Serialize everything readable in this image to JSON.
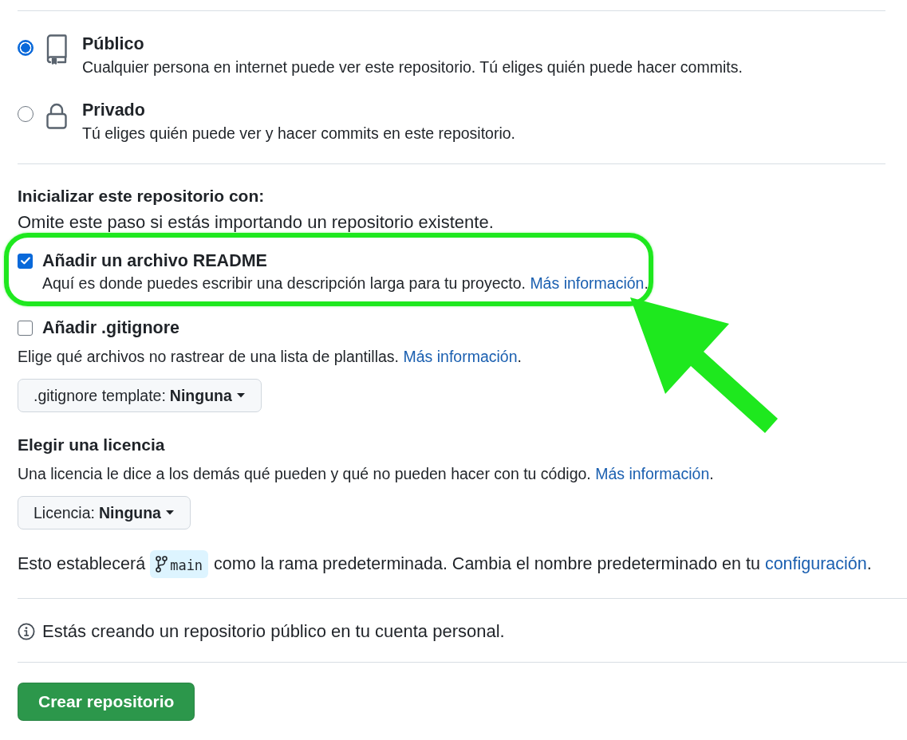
{
  "visibility_options": [
    {
      "kind": "public",
      "title": "Público",
      "description": "Cualquier persona en internet puede ver este repositorio. Tú eliges quién puede hacer commits.",
      "selected": true
    },
    {
      "kind": "private",
      "title": "Privado",
      "description": "Tú eliges quién puede ver y hacer commits en este repositorio.",
      "selected": false
    }
  ],
  "initialize": {
    "heading": "Inicializar este repositorio con:",
    "note": "Omite este paso si estás importando un repositorio existente.",
    "options": [
      {
        "label": "Añadir un archivo README",
        "checked": true,
        "highlighted": true,
        "description": "Aquí es donde puedes escribir una descripción larga para tu proyecto.",
        "link": "Más información",
        "after_link": "."
      },
      {
        "label": "Añadir .gitignore",
        "checked": false,
        "highlighted": false
      }
    ]
  },
  "gitignore_template": {
    "description": "Elige qué archivos no rastrear de una lista de plantillas.",
    "link": "Más información",
    "after_link": ".",
    "dropdown": {
      "label": ".gitignore template:",
      "value": "Ninguna"
    }
  },
  "license": {
    "heading": "Elegir una licencia",
    "description": "Una licencia le dice a los demás qué pueden y qué no pueden hacer con tu código.",
    "link": "Más información",
    "after_link": ".",
    "dropdown": {
      "label": "Licencia:",
      "value": "Ninguna"
    }
  },
  "default_branch": {
    "before": "Esto establecerá",
    "branch": "main",
    "after": "como la rama predeterminada. Cambia el nombre predeterminado en tu",
    "link": "configuración",
    "after_link": "."
  },
  "notice": "Estás creando un repositorio público en tu cuenta personal.",
  "submit_button": "Crear repositorio"
}
